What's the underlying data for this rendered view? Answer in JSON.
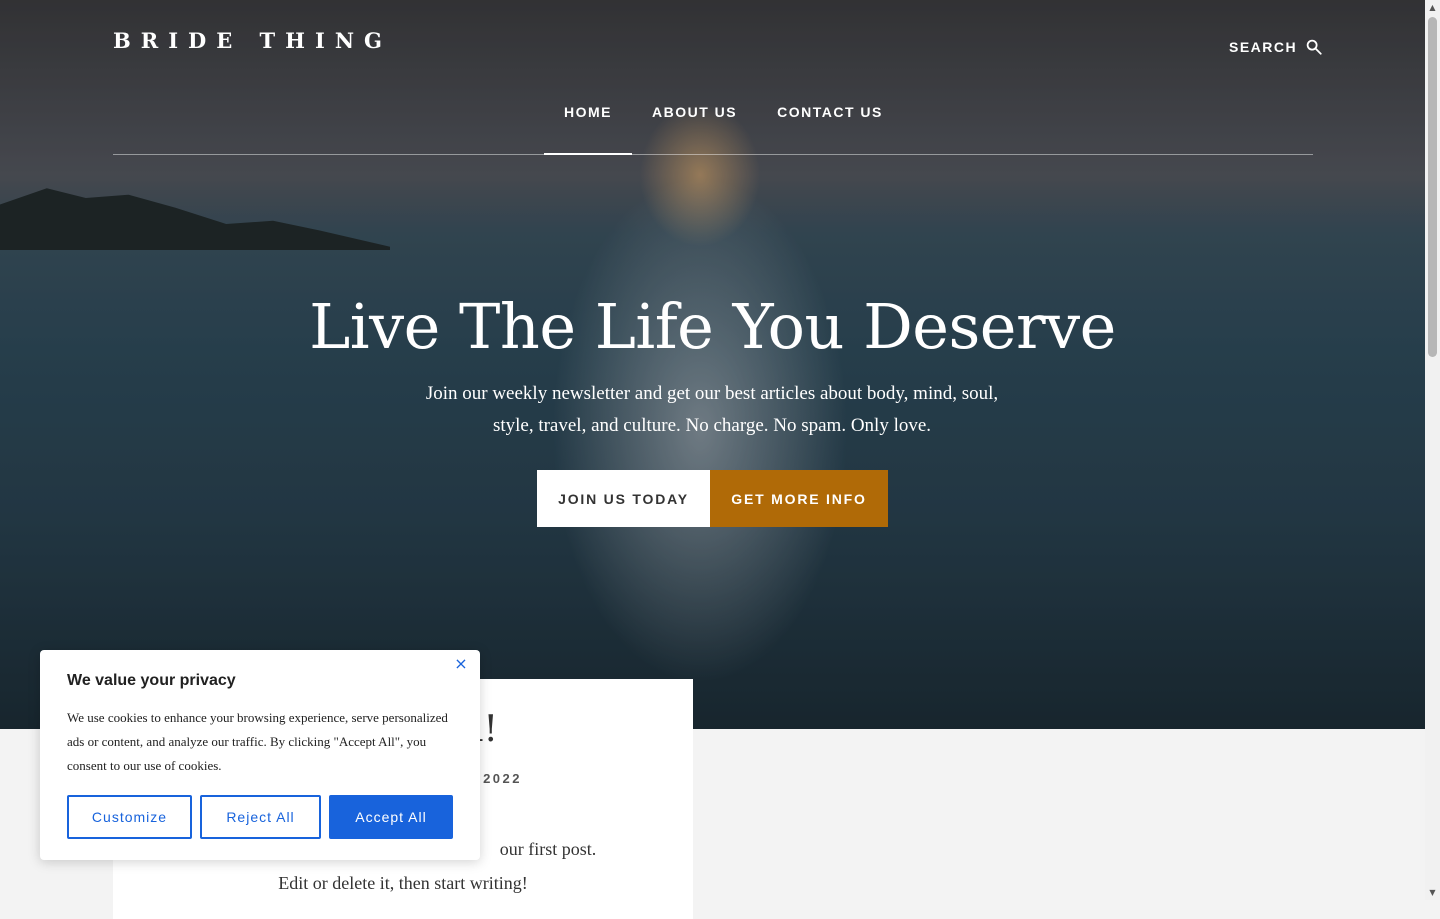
{
  "header": {
    "logo": "BRIDE THING",
    "search_label": "SEARCH",
    "nav": [
      {
        "label": "HOME",
        "active": true
      },
      {
        "label": "ABOUT US"
      },
      {
        "label": "CONTACT US"
      }
    ]
  },
  "hero": {
    "title": "Live The Life You Deserve",
    "subtitle": "Join our weekly newsletter and get our best articles about body, mind, soul, style, travel, and culture. No charge. No spam. Only love.",
    "primary_button": "JOIN US TODAY",
    "secondary_button": "GET MORE INFO"
  },
  "post": {
    "title_visible": "d!",
    "meta_visible": "2022",
    "body_line1_visible": "our first post.",
    "body_line2": "Edit or delete it, then start writing!"
  },
  "cookie": {
    "title": "We value your privacy",
    "text": "We use cookies to enhance your browsing experience, serve personalized ads or content, and analyze our traffic. By clicking \"Accept All\", you consent to our use of cookies.",
    "close_icon": "×",
    "customize": "Customize",
    "reject": "Reject All",
    "accept": "Accept All"
  },
  "colors": {
    "accent": "#b06a07",
    "cookie_blue": "#1863dc"
  },
  "icons": {
    "search": "search-icon",
    "close": "close-icon"
  }
}
